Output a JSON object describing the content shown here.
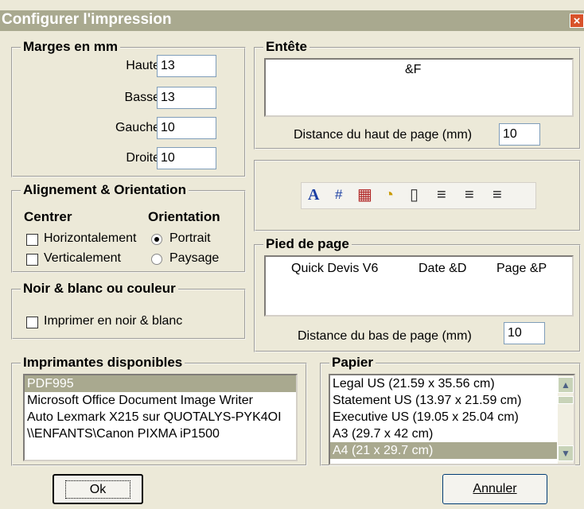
{
  "window": {
    "title": "Configurer l'impression",
    "close_label": "×"
  },
  "margins": {
    "title": "Marges en mm",
    "fields": [
      {
        "label": "Haute",
        "value": "13"
      },
      {
        "label": "Basse",
        "value": "13"
      },
      {
        "label": "Gauche",
        "value": "10"
      },
      {
        "label": "Droite",
        "value": "10"
      }
    ]
  },
  "alignment": {
    "title": "Alignement & Orientation",
    "center_label": "Centrer",
    "orientation_label": "Orientation",
    "horizontal": "Horizontalement",
    "vertical": "Verticalement",
    "portrait": "Portrait",
    "landscape": "Paysage",
    "selected_orientation": "Portrait"
  },
  "color": {
    "title": "Noir & blanc ou couleur",
    "bw_label": "Imprimer en noir & blanc",
    "bw_checked": false
  },
  "header": {
    "title": "Entête",
    "text": "&F",
    "distance_label": "Distance du haut de page (mm)",
    "distance_value": "10"
  },
  "toolbar": {
    "icons": [
      "font-icon",
      "page-number-icon",
      "date-icon",
      "time-icon",
      "file-name-icon",
      "align-left-icon",
      "align-center-icon",
      "align-right-icon"
    ],
    "glyphs": [
      "A",
      "#",
      "▦",
      "◔",
      "▯",
      "≡",
      "≡",
      "≡"
    ]
  },
  "footer": {
    "title": "Pied de page",
    "text_left": "Quick Devis V6",
    "text_center": "Date &D",
    "text_right": "Page &P",
    "distance_label": "Distance du bas de page (mm)",
    "distance_value": "10"
  },
  "printers": {
    "title": "Imprimantes disponibles",
    "items": [
      "PDF995",
      "Microsoft Office Document Image Writer",
      "Auto Lexmark X215 sur QUOTALYS-PYK4OI",
      "\\\\ENFANTS\\Canon PIXMA iP1500"
    ],
    "selected_index": 0
  },
  "paper": {
    "title": "Papier",
    "items": [
      "Legal US (21.59 x 35.56 cm)",
      "Statement US (13.97 x 21.59 cm)",
      "Executive US (19.05 x 25.04 cm)",
      "A3 (29.7 x 42 cm)",
      "A4 (21 x 29.7 cm)"
    ],
    "selected_index": 4
  },
  "buttons": {
    "ok": "Ok",
    "cancel": "Annuler"
  }
}
